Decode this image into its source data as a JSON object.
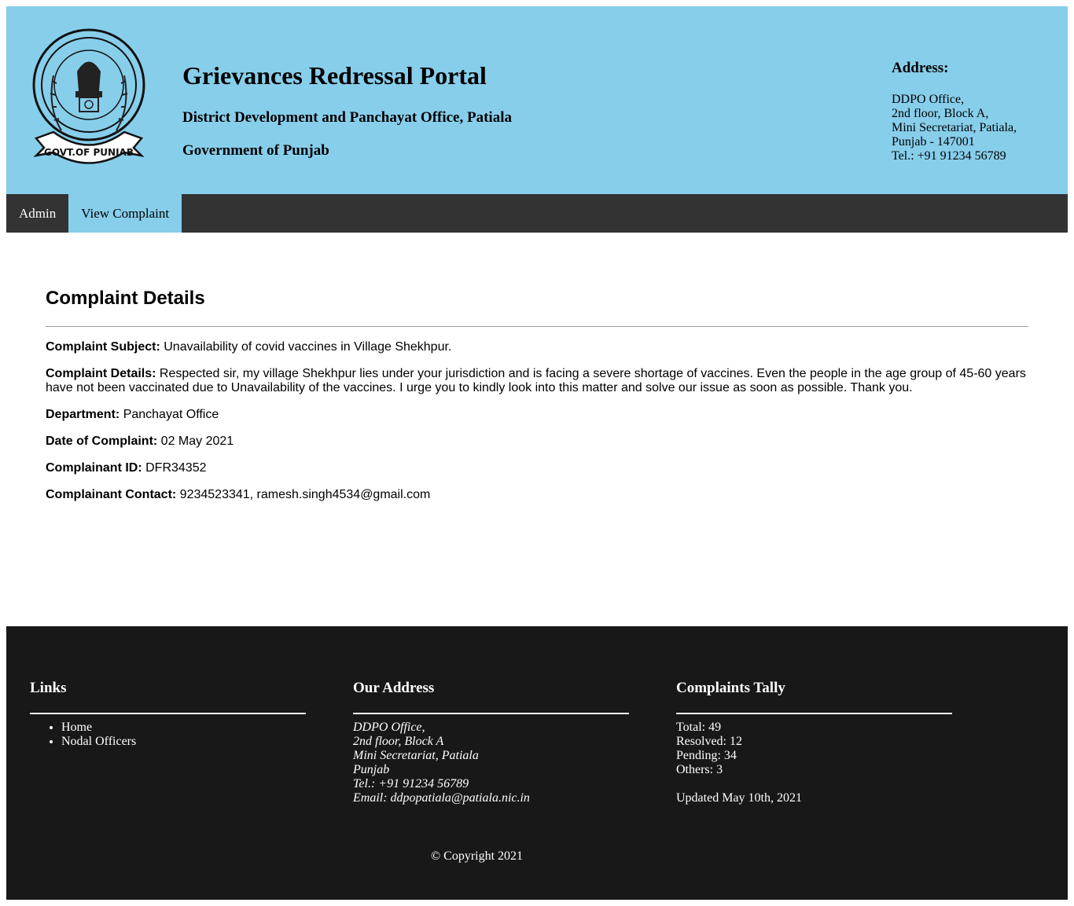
{
  "header": {
    "title": "Grievances Redressal Portal",
    "subtitle": "District Development and Panchayat Office, Patiala",
    "government": "Government of Punjab",
    "emblem_text": "GOVT.OF PUNJAB",
    "address_heading": "Address:",
    "address_lines": [
      "DDPO Office,",
      "2nd floor, Block A,",
      "Mini Secretariat, Patiala,",
      "Punjab - 147001",
      "Tel.: +91 91234 56789"
    ]
  },
  "nav": {
    "items": [
      {
        "label": "Admin",
        "active": false
      },
      {
        "label": "View Complaint",
        "active": true
      }
    ]
  },
  "complaint": {
    "heading": "Complaint Details",
    "subject_label": "Complaint Subject:",
    "subject": "Unavailability of covid vaccines in Village Shekhpur.",
    "details_label": "Complaint Details:",
    "details": "Respected sir, my village Shekhpur lies under your jurisdiction and is facing a severe shortage of vaccines. Even the people in the age group of 45-60 years have not been vaccinated due to Unavailability of the vaccines. I urge you to kindly look into this matter and solve our issue as soon as possible. Thank you.",
    "department_label": "Department:",
    "department": "Panchayat Office",
    "date_label": "Date of Complaint:",
    "date": "02 May 2021",
    "id_label": "Complainant ID:",
    "id": "DFR34352",
    "contact_label": "Complainant Contact:",
    "contact": "9234523341, ramesh.singh4534@gmail.com"
  },
  "footer": {
    "links_heading": "Links",
    "links": [
      "Home",
      "Nodal Officers"
    ],
    "address_heading": "Our Address",
    "address_lines": [
      "DDPO Office,",
      "2nd floor, Block A",
      "Mini Secretariat, Patiala",
      "Punjab",
      "Tel.: +91 91234 56789",
      "Email: ddpopatiala@patiala.nic.in"
    ],
    "tally_heading": "Complaints Tally",
    "tally": {
      "total": "Total: 49",
      "resolved": "Resolved: 12",
      "pending": "Pending: 34",
      "others": "Others: 3",
      "updated": "Updated May 10th, 2021"
    },
    "copyright": "© Copyright 2021"
  },
  "colors": {
    "header_bg": "#87ceeb",
    "nav_bg": "#333333",
    "nav_active": "#87ceeb",
    "footer_bg": "#181818"
  }
}
